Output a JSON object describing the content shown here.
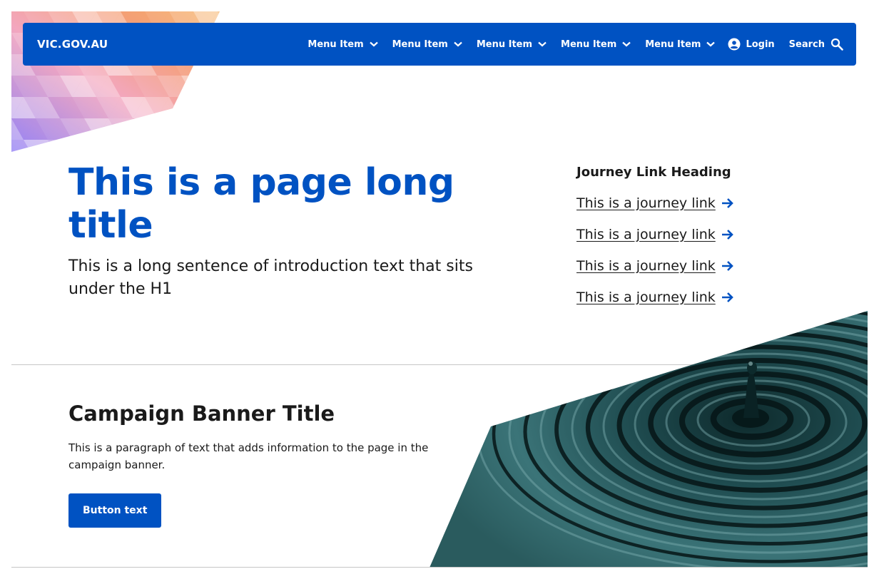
{
  "header": {
    "logo": "VIC.GOV.AU",
    "menu_items": [
      "Menu Item",
      "Menu Item",
      "Menu Item",
      "Menu Item",
      "Menu Item"
    ],
    "login_label": "Login",
    "search_label": "Search"
  },
  "hero": {
    "title": "This is a page long title",
    "intro": "This is a long sentence of introduction text that sits under the H1"
  },
  "journey": {
    "heading": "Journey Link Heading",
    "links": [
      "This is a journey link",
      "This is a journey link",
      "This is a journey link",
      "This is a journey link"
    ]
  },
  "campaign": {
    "title": "Campaign Banner Title",
    "text": "This is a paragraph of text that adds information to the page in the campaign banner.",
    "button_label": "Button text"
  },
  "colors": {
    "brand": "#0052c2",
    "text": "#1a1a1a",
    "divider": "#c6c6c6"
  },
  "icons": {
    "dropdown": "chevron-down-icon",
    "login": "user-circle-icon",
    "search": "search-icon",
    "journey_arrow": "arrow-right-icon"
  }
}
